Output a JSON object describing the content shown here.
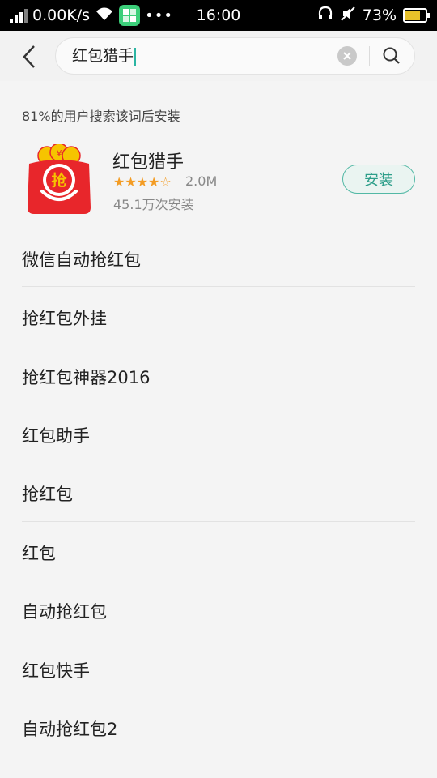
{
  "status_bar": {
    "net_speed": "0.00K/s",
    "time": "16:00",
    "battery": "73%",
    "icons": [
      "signal-icon",
      "wifi-icon",
      "app-notification-icon",
      "more-dots-icon",
      "headset-icon",
      "mute-icon",
      "battery-icon"
    ]
  },
  "search": {
    "query": "红包猎手",
    "icons": [
      "back-arrow-icon",
      "clear-icon",
      "search-icon"
    ]
  },
  "hint": "81%的用户搜索该词后安装",
  "app": {
    "name": "红包猎手",
    "rating_stars": "★★★★☆",
    "rating": 4,
    "size": "2.0M",
    "installs": "45.1万次安装",
    "install_label": "安装",
    "icon_glyph": "抢"
  },
  "suggestions": [
    "微信自动抢红包",
    "抢红包外挂",
    "抢红包神器2016",
    "红包助手",
    "抢红包",
    "红包",
    "自动抢红包",
    "红包快手",
    "自动抢红包2"
  ],
  "colors": {
    "accent": "#2bb5a3",
    "star": "#f39c24",
    "icon_red": "#e8262b",
    "icon_gold": "#f6c400"
  }
}
